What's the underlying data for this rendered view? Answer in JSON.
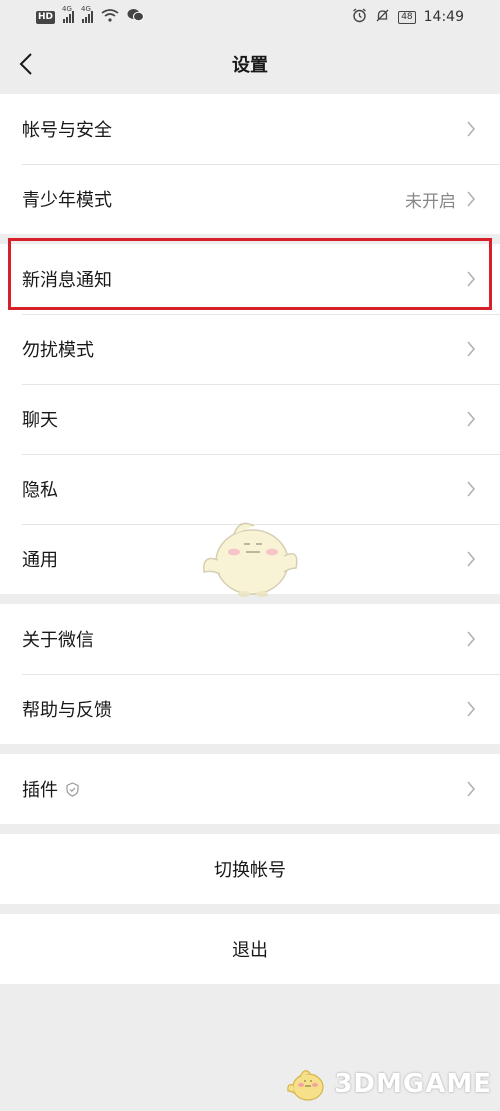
{
  "status_bar": {
    "hd_label": "HD",
    "hd_sub": "2",
    "net1": "4G",
    "net2": "4G",
    "battery": "48",
    "time": "14:49"
  },
  "nav": {
    "title": "设置"
  },
  "groups": {
    "account": [
      {
        "label": "帐号与安全",
        "value": ""
      },
      {
        "label": "青少年模式",
        "value": "未开启"
      }
    ],
    "general": [
      {
        "label": "新消息通知"
      },
      {
        "label": "勿扰模式"
      },
      {
        "label": "聊天"
      },
      {
        "label": "隐私"
      },
      {
        "label": "通用"
      }
    ],
    "about": [
      {
        "label": "关于微信"
      },
      {
        "label": "帮助与反馈"
      }
    ],
    "plugins": [
      {
        "label": "插件"
      }
    ]
  },
  "actions": {
    "switch_account": "切换帐号",
    "logout": "退出"
  },
  "watermark": {
    "text": "3DMGAME"
  },
  "colors": {
    "highlight": "#d8202a",
    "background": "#ededed"
  }
}
